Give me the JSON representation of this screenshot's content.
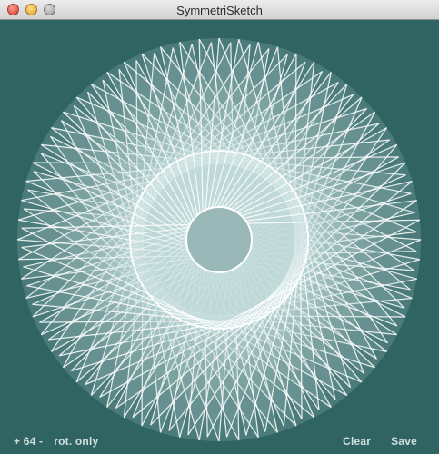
{
  "window": {
    "title": "SymmetriSketch"
  },
  "footer": {
    "symmetry_count": "+ 64 -",
    "mode": "rot. only",
    "clear_label": "Clear",
    "save_label": "Save"
  },
  "colors": {
    "background": "#2f6463",
    "stroke": "#ffffff",
    "fill": "#c8dede",
    "center": "#9bb8b8"
  }
}
